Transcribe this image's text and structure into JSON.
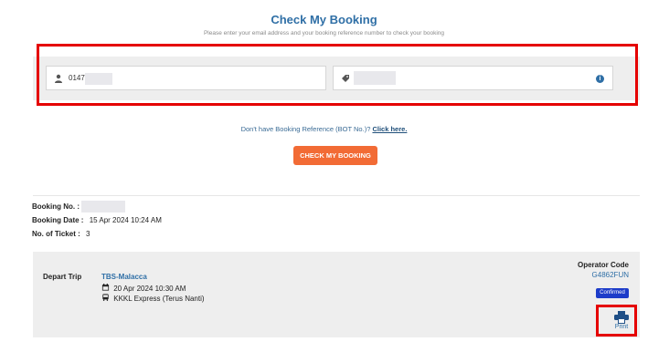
{
  "header": {
    "title": "Check My Booking",
    "subtitle": "Please enter your email address and your booking reference number to check your booking"
  },
  "form": {
    "email_value": "0147",
    "reference_value": "",
    "user_icon": "user-icon",
    "ticket_icon": "ticket-icon",
    "info_icon": "info-icon"
  },
  "links": {
    "no_reference_text": "Don't have Booking Reference (BOT No.)?",
    "click_here": "Click here."
  },
  "actions": {
    "check_button": "CHECK MY BOOKING"
  },
  "booking": {
    "number_label": "Booking No. :",
    "number_value": "",
    "date_label": "Booking Date :",
    "date_value": "15 Apr 2024 10:24 AM",
    "tickets_label": "No. of Ticket :",
    "tickets_value": "3"
  },
  "trip": {
    "depart_label": "Depart Trip",
    "route": "TBS-Malacca",
    "datetime": "20 Apr 2024 10:30 AM",
    "operator_name": "KKKL Express (Terus Nanti)",
    "operator_code_label": "Operator Code",
    "operator_code": "G4862FUN",
    "status": "Confirmed",
    "print_label": "Print"
  },
  "colors": {
    "accent_blue": "#2f6fa6",
    "button_orange": "#f26b35",
    "badge_blue": "#1d3cc9",
    "highlight_red": "#e50000",
    "panel_gray": "#eeeeee"
  }
}
